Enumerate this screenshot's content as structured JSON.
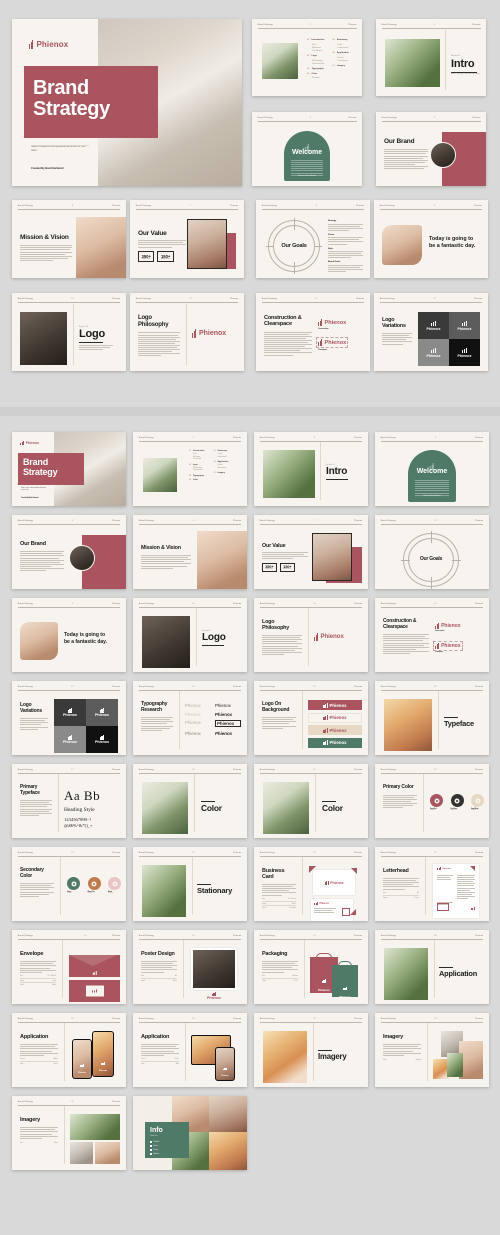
{
  "brand": {
    "name": "Phienox",
    "colors": {
      "rose": "#a9545e",
      "green": "#4f7a68",
      "cream": "#f7f4ef",
      "dark": "#333333",
      "ink": "#1d1b1a"
    }
  },
  "cover": {
    "logo": "Phienox",
    "title_line1": "Brand",
    "title_line2": "Strategy",
    "subtitle": "Need to create a brand guideline document for your client",
    "credit": "Created By Basil Harlward"
  },
  "header": {
    "left": "Brand Strategy",
    "right": "Phienox"
  },
  "toc": {
    "col1": [
      {
        "num": "01.",
        "label": "Introduction",
        "subs": [
          "Intro",
          "Welcome",
          "Our Brand",
          "Mission & Vision"
        ]
      },
      {
        "num": "02.",
        "label": "Logo",
        "subs": [
          "Logo Philosophy",
          "Construction",
          "Logo Variations"
        ]
      },
      {
        "num": "03.",
        "label": "Typography",
        "subs": [
          "Typeface",
          "Primary Typeface"
        ]
      },
      {
        "num": "04.",
        "label": "Color",
        "subs": [
          "Primary Color"
        ]
      }
    ],
    "col2": [
      {
        "num": "05.",
        "label": "Stationary",
        "subs": [
          "Business Card",
          "Letterhead",
          "Envelope"
        ]
      },
      {
        "num": "06.",
        "label": "Application",
        "subs": [
          "Poster",
          "Packaging"
        ]
      },
      {
        "num": "07.",
        "label": "Imagery",
        "subs": [
          "Info"
        ]
      }
    ]
  },
  "slides": {
    "intro": {
      "eyebrow": "Section 01",
      "title": "Intro",
      "caption": "Brand Strategy Guideline Document"
    },
    "welcome": {
      "title": "Welcome",
      "footer": "Phienox Brand Manual"
    },
    "our_brand": {
      "title": "Our Brand"
    },
    "mission_vision": {
      "title": "Mission &  Vision"
    },
    "our_value": {
      "title": "Our Value",
      "stats": [
        {
          "value": "350+",
          "label": "Happy Client"
        },
        {
          "value": "150+",
          "label": "Award Winner"
        }
      ]
    },
    "our_goals": {
      "title": "Our Goals",
      "items": [
        "Strategy",
        "Vision",
        "Style",
        "Brand Goals"
      ]
    },
    "quote": {
      "line1": "Today is going to",
      "line2": "be a fantastic day."
    },
    "logo": {
      "eyebrow": "Section 02",
      "title": "Logo"
    },
    "logo_philosophy": {
      "title": "Logo Philosophy",
      "logo": "Phienox"
    },
    "construction": {
      "title": "Construction & Clearspace",
      "label1": "Construction",
      "label2": "Clearspace"
    },
    "logo_variations": {
      "title": "Logo Variations",
      "tiles": [
        "Phienox",
        "Phienox",
        "Phienox",
        "Phienox"
      ]
    },
    "typography_research": {
      "title": "Typography Research",
      "samples": [
        "Phienox",
        "Phienox",
        "Phienox",
        "Phienox",
        "Phienox",
        "Phienox",
        "Phienox",
        "Phienox"
      ]
    },
    "logo_on_background": {
      "title": "Logo On Background",
      "bars": [
        {
          "bg": "#a9545e",
          "label": "Phienox"
        },
        {
          "bg": "#f7f4ef",
          "label": "Phienox"
        },
        {
          "bg": "#e6d9c3",
          "label": "Phienox"
        },
        {
          "bg": "#4f7a68",
          "label": "Phienox"
        }
      ]
    },
    "typeface": {
      "eyebrow": "Section 03",
      "title": "Typeface"
    },
    "primary_typeface": {
      "title": "Primary Typeface",
      "sample": "Aa Bb",
      "style": "Heading Style",
      "numerals": "1234567890~!",
      "symbols": "@#$%^&*()_+"
    },
    "color": {
      "eyebrow": "Section 04",
      "title": "Color"
    },
    "primary_color": {
      "title": "Primary Color",
      "swatches": [
        {
          "name": "Rose Red",
          "hex": "#a9545e"
        },
        {
          "name": "Dark Grey",
          "hex": "#333333"
        },
        {
          "name": "Sand Beige",
          "hex": "#e6d9c3"
        }
      ]
    },
    "secondary_color": {
      "title": "Secondary Color",
      "swatches": [
        {
          "name": "Green",
          "hex": "#4f7a68"
        },
        {
          "name": "Warm Clay",
          "hex": "#c07a4e"
        },
        {
          "name": "Blush",
          "hex": "#e9c4c6"
        }
      ]
    },
    "stationary": {
      "eyebrow": "Section 05",
      "title": "Stationary"
    },
    "business_card": {
      "title": "Business Card",
      "logo": "Phienox"
    },
    "letterhead": {
      "title": "Letterhead"
    },
    "envelope": {
      "title": "Envelope"
    },
    "poster_design": {
      "title": "Poster Design",
      "logo": "Phienox"
    },
    "packaging": {
      "title": "Packaging",
      "bag1": "Phienox",
      "bag2": "Phienox"
    },
    "application": {
      "eyebrow": "Section 06",
      "title": "Application"
    },
    "application_mobile": {
      "title": "Application",
      "logo": "Phienox"
    },
    "application_tablet": {
      "title": "Application",
      "logo": "Phienox"
    },
    "imagery": {
      "eyebrow": "Section 07",
      "title": "Imagery"
    },
    "imagery_grid": {
      "title": "Imagery"
    },
    "imagery_collage": {
      "title": "Imagery"
    },
    "info": {
      "title": "Info",
      "subtitle": "Thank You",
      "items": [
        "Website",
        "Email",
        "Phone",
        "Address"
      ]
    }
  },
  "page_numbers": {
    "toc": "2",
    "intro": "3",
    "welcome": "4",
    "our_brand": "5",
    "mission": "6",
    "value": "7",
    "goals": "8",
    "quote": "9",
    "logo": "10",
    "philosophy": "11",
    "construction": "12",
    "variations": "13",
    "typo": "14",
    "logo_bg": "15",
    "typeface": "16",
    "primary_typeface": "17",
    "color": "18",
    "color2": "19",
    "primary_color": "20",
    "secondary_color": "21",
    "stationary": "22",
    "card": "23",
    "letterhead": "24",
    "envelope": "25",
    "poster": "26",
    "packaging": "27",
    "application": "28",
    "app_mobile": "29",
    "app_tablet": "30",
    "img": "31",
    "img_grid": "32",
    "img_collage": "33",
    "info": "34"
  }
}
